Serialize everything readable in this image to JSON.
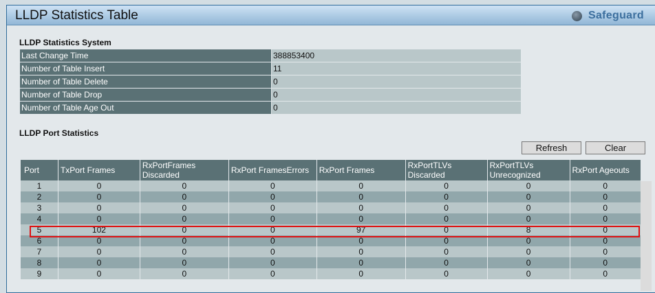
{
  "header": {
    "title": "LLDP Statistics Table",
    "brand": "Safeguard"
  },
  "system": {
    "title": "LLDP Statistics System",
    "rows": [
      {
        "label": "Last Change Time",
        "value": "388853400"
      },
      {
        "label": "Number of Table Insert",
        "value": "11"
      },
      {
        "label": "Number of Table Delete",
        "value": "0"
      },
      {
        "label": "Number of Table Drop",
        "value": "0"
      },
      {
        "label": "Number of Table Age Out",
        "value": "0"
      }
    ]
  },
  "ports": {
    "title": "LLDP Port Statistics",
    "refresh_label": "Refresh",
    "clear_label": "Clear",
    "columns": [
      "Port",
      "TxPort Frames",
      "RxPortFrames Discarded",
      "RxPort FramesErrors",
      "RxPort Frames",
      "RxPortTLVs Discarded",
      "RxPortTLVs Unrecognized",
      "RxPort Ageouts"
    ],
    "rows": [
      [
        "1",
        "0",
        "0",
        "0",
        "0",
        "0",
        "0",
        "0"
      ],
      [
        "2",
        "0",
        "0",
        "0",
        "0",
        "0",
        "0",
        "0"
      ],
      [
        "3",
        "0",
        "0",
        "0",
        "0",
        "0",
        "0",
        "0"
      ],
      [
        "4",
        "0",
        "0",
        "0",
        "0",
        "0",
        "0",
        "0"
      ],
      [
        "5",
        "102",
        "0",
        "0",
        "97",
        "0",
        "8",
        "0"
      ],
      [
        "6",
        "0",
        "0",
        "0",
        "0",
        "0",
        "0",
        "0"
      ],
      [
        "7",
        "0",
        "0",
        "0",
        "0",
        "0",
        "0",
        "0"
      ],
      [
        "8",
        "0",
        "0",
        "0",
        "0",
        "0",
        "0",
        "0"
      ],
      [
        "9",
        "0",
        "0",
        "0",
        "0",
        "0",
        "0",
        "0"
      ]
    ],
    "highlighted_port": "5"
  }
}
